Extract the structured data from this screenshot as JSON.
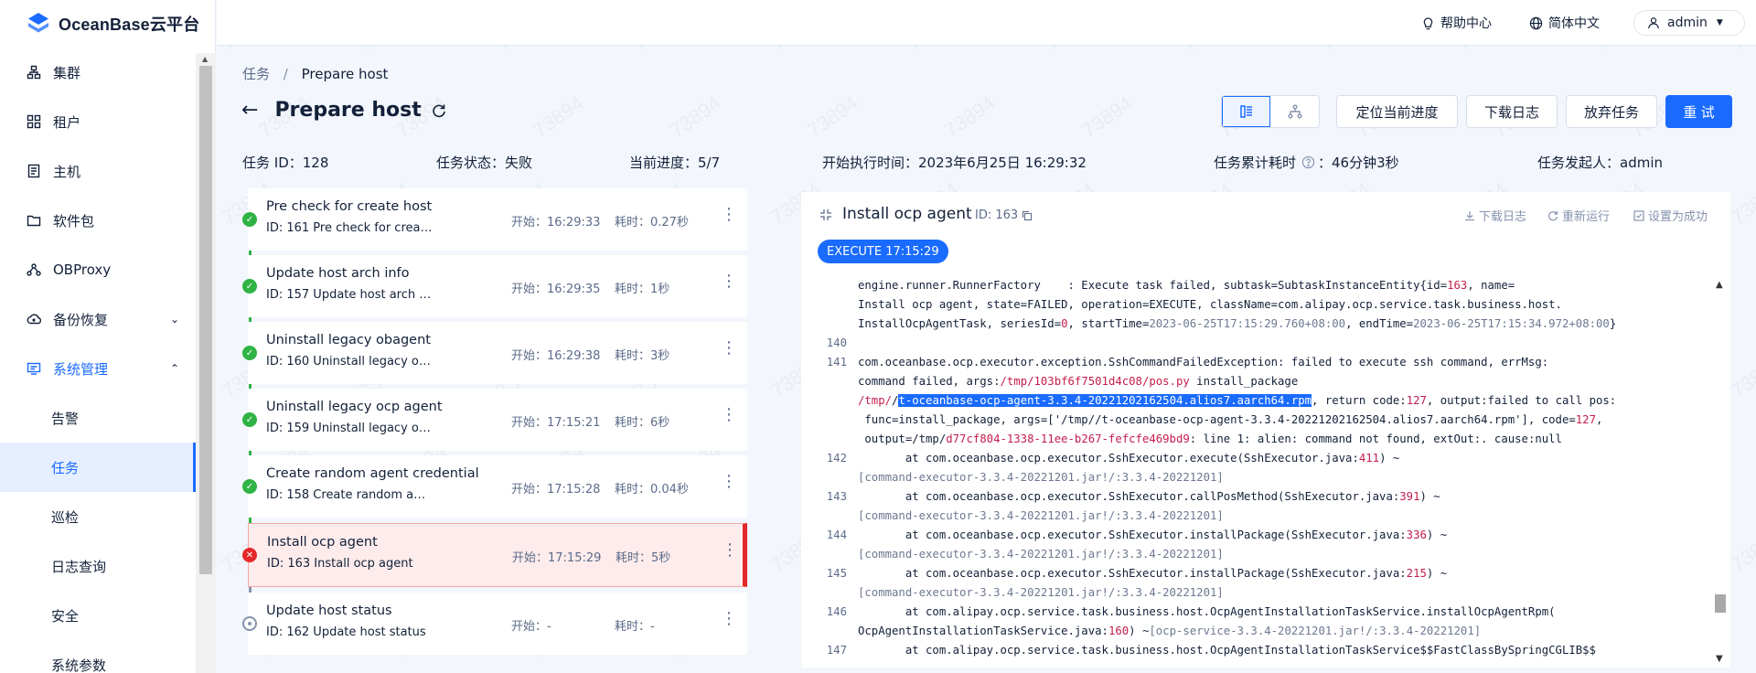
{
  "app": {
    "logo_text": "OceanBase云平台"
  },
  "topbar": {
    "help": "帮助中心",
    "language": "简体中文",
    "user": "admin"
  },
  "sidebar": {
    "items": [
      {
        "label": "集群",
        "icon": "cluster-icon"
      },
      {
        "label": "租户",
        "icon": "tenant-icon"
      },
      {
        "label": "主机",
        "icon": "host-icon"
      },
      {
        "label": "软件包",
        "icon": "folder-icon"
      },
      {
        "label": "OBProxy",
        "icon": "proxy-icon"
      },
      {
        "label": "备份恢复",
        "icon": "backup-icon"
      },
      {
        "label": "系统管理",
        "icon": "system-icon"
      },
      {
        "label": "告警"
      },
      {
        "label": "任务"
      },
      {
        "label": "巡检"
      },
      {
        "label": "日志查询"
      },
      {
        "label": "安全"
      },
      {
        "label": "系统参数"
      }
    ]
  },
  "breadcrumb": {
    "parent": "任务",
    "separator": "/",
    "current": "Prepare host"
  },
  "page": {
    "title": "Prepare host"
  },
  "actions": {
    "locate": "定位当前进度",
    "download_log": "下载日志",
    "abandon": "放弃任务",
    "retry": "重 试"
  },
  "info": {
    "task_id": "任务 ID：128",
    "status": "任务状态：失败",
    "progress": "当前进度：5/7",
    "start_time": "开始执行时间：2023年6月25日 16:29:32",
    "elapsed_label": "任务累计耗时",
    "elapsed_value": "：46分钟3秒",
    "initiator": "任务发起人：admin"
  },
  "steps": [
    {
      "title": "Pre check for create host",
      "sub": "ID: 161  Pre check for creat...",
      "start": "开始：16:29:33",
      "duration": "耗时：0.27秒",
      "state": "ok"
    },
    {
      "title": "Update host arch info",
      "sub": "ID: 157  Update host arch i...",
      "start": "开始：16:29:35",
      "duration": "耗时：1秒",
      "state": "ok"
    },
    {
      "title": "Uninstall legacy obagent",
      "sub": "ID: 160  Uninstall legacy ob...",
      "start": "开始：16:29:38",
      "duration": "耗时：3秒",
      "state": "ok"
    },
    {
      "title": "Uninstall legacy ocp agent",
      "sub": "ID: 159  Uninstall legacy oc...",
      "start": "开始：17:15:21",
      "duration": "耗时：6秒",
      "state": "ok"
    },
    {
      "title": "Create random agent credential",
      "sub": "ID: 158  Create random age...",
      "start": "开始：17:15:28",
      "duration": "耗时：0.04秒",
      "state": "ok"
    },
    {
      "title": "Install ocp agent",
      "sub": "ID: 163  Install ocp agent",
      "start": "开始：17:15:29",
      "duration": "耗时：5秒",
      "state": "failed"
    },
    {
      "title": "Update host status",
      "sub": "ID: 162  Update host status",
      "start": "开始：-",
      "duration": "耗时：-",
      "state": "pending"
    }
  ],
  "log": {
    "title": "Install ocp agent",
    "id": "ID: 163",
    "download": "下载日志",
    "rerun": "重新运行",
    "set_success": "设置为成功",
    "exec_tag": "EXECUTE 17:15:29",
    "lines": [
      {
        "ln": "",
        "parts": [
          [
            "engine.runner.RunnerFactory    : Execute task failed, subtask=SubtaskInstanceEntity{id=",
            ""
          ],
          [
            "163",
            "red"
          ],
          [
            ", name=",
            ""
          ]
        ]
      },
      {
        "ln": "",
        "parts": [
          [
            "Install ocp agent, state=FAILED, operation=EXECUTE, className=com.alipay.ocp.service.task.business.host.",
            ""
          ]
        ]
      },
      {
        "ln": "",
        "parts": [
          [
            "InstallOcpAgentTask, seriesId=",
            ""
          ],
          [
            "0",
            "red"
          ],
          [
            ", startTime=",
            ""
          ],
          [
            "2023-06-25T17:15:29.760+08:00",
            "gray"
          ],
          [
            ", endTime=",
            ""
          ],
          [
            "2023-06-25T17:15:34.972+08:00",
            "gray"
          ],
          [
            "}",
            ""
          ]
        ]
      },
      {
        "ln": "140",
        "parts": []
      },
      {
        "ln": "141",
        "parts": [
          [
            "com.oceanbase.ocp.executor.exception.SshCommandFailedException: failed to execute ssh command, errMsg:",
            ""
          ]
        ]
      },
      {
        "ln": "",
        "parts": [
          [
            "command failed, args:",
            ""
          ],
          [
            "/tmp/103bf6f7501d4c08/pos.py",
            "red"
          ],
          [
            " install_package",
            ""
          ]
        ]
      },
      {
        "ln": "",
        "parts": [
          [
            "/tmp/",
            "red"
          ],
          [
            "/",
            ""
          ],
          [
            "t-oceanbase-ocp-agent-3.3.4-20221202162504.alios7.aarch64.rpm",
            "sel"
          ],
          [
            ", return code:",
            ""
          ],
          [
            "127",
            "red"
          ],
          [
            ", output:failed to call pos:",
            ""
          ]
        ]
      },
      {
        "ln": "",
        "parts": [
          [
            " func=install_package, args=['/tmp//t-oceanbase-ocp-agent-3.3.4-20221202162504.alios7.aarch64.rpm'], code=",
            ""
          ],
          [
            "127",
            "red"
          ],
          [
            ",",
            ""
          ]
        ]
      },
      {
        "ln": "",
        "parts": [
          [
            " output=/tmp/",
            ""
          ],
          [
            "d77cf804-1338-11ee-b267-fefcfe469bd9",
            "red"
          ],
          [
            ": line 1: alien: command not found, extOut:. cause:null",
            ""
          ]
        ]
      },
      {
        "ln": "142",
        "parts": [
          [
            "       at com.oceanbase.ocp.executor.SshExecutor.execute(SshExecutor.java:",
            ""
          ],
          [
            "411",
            "red"
          ],
          [
            ") ~",
            ""
          ]
        ]
      },
      {
        "ln": "",
        "parts": [
          [
            "[command-executor-3.3.4-20221201.jar!/:3.3.4-20221201]",
            "gray"
          ]
        ]
      },
      {
        "ln": "143",
        "parts": [
          [
            "       at com.oceanbase.ocp.executor.SshExecutor.callPosMethod(SshExecutor.java:",
            ""
          ],
          [
            "391",
            "red"
          ],
          [
            ") ~",
            ""
          ]
        ]
      },
      {
        "ln": "",
        "parts": [
          [
            "[command-executor-3.3.4-20221201.jar!/:3.3.4-20221201]",
            "gray"
          ]
        ]
      },
      {
        "ln": "144",
        "parts": [
          [
            "       at com.oceanbase.ocp.executor.SshExecutor.installPackage(SshExecutor.java:",
            ""
          ],
          [
            "336",
            "red"
          ],
          [
            ") ~",
            ""
          ]
        ]
      },
      {
        "ln": "",
        "parts": [
          [
            "[command-executor-3.3.4-20221201.jar!/:3.3.4-20221201]",
            "gray"
          ]
        ]
      },
      {
        "ln": "145",
        "parts": [
          [
            "       at com.oceanbase.ocp.executor.SshExecutor.installPackage(SshExecutor.java:",
            ""
          ],
          [
            "215",
            "red"
          ],
          [
            ") ~",
            ""
          ]
        ]
      },
      {
        "ln": "",
        "parts": [
          [
            "[command-executor-3.3.4-20221201.jar!/:3.3.4-20221201]",
            "gray"
          ]
        ]
      },
      {
        "ln": "146",
        "parts": [
          [
            "       at com.alipay.ocp.service.task.business.host.OcpAgentInstallationTaskService.installOcpAgentRpm(",
            ""
          ]
        ]
      },
      {
        "ln": "",
        "parts": [
          [
            "OcpAgentInstallationTaskService.java:",
            ""
          ],
          [
            "160",
            "red"
          ],
          [
            ") ~",
            ""
          ],
          [
            "[ocp-service-3.3.4-20221201.jar!/:3.3.4-20221201]",
            "gray"
          ]
        ]
      },
      {
        "ln": "147",
        "parts": [
          [
            "       at com.alipay.ocp.service.task.business.host.OcpAgentInstallationTaskService$$FastClassBySpringCGLIB$$",
            ""
          ]
        ]
      }
    ]
  },
  "watermark": "73894",
  "colors": {
    "primary": "#1a6bff",
    "success": "#2fb344",
    "danger": "#e4282a",
    "text": "#132039"
  }
}
